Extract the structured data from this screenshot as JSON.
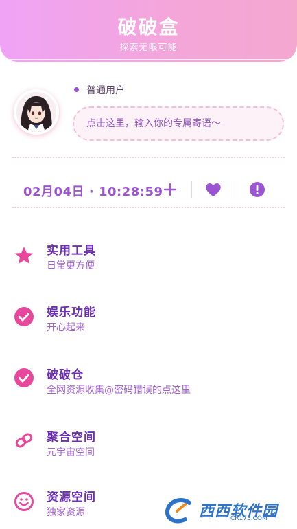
{
  "header": {
    "title": "破破盒",
    "subtitle": "探索无限可能"
  },
  "profile": {
    "user_type": "普通用户",
    "motto_placeholder": "点击这里，输入你的专属寄语～"
  },
  "datebar": {
    "datetime": "02月04日 · 10:28:59",
    "plus_icon": "plus-icon",
    "heart_icon": "heart-icon",
    "alert_icon": "alert-icon"
  },
  "menu": [
    {
      "title": "实用工具",
      "desc": "日常更方便",
      "icon": "star-icon"
    },
    {
      "title": "娱乐功能",
      "desc": "开心起来",
      "icon": "check-circle-icon"
    },
    {
      "title": "破破仓",
      "desc": "全网资源收集@密码错误的点这里",
      "icon": "check-circle-icon"
    },
    {
      "title": "聚合空间",
      "desc": "元宇宙空间",
      "icon": "link-icon"
    },
    {
      "title": "资源空间",
      "desc": "独家资源",
      "icon": "smile-icon"
    }
  ],
  "watermark": {
    "text": "西西软件园",
    "sub": "CR173.COM"
  },
  "colors": {
    "accent": "#9c55d2",
    "pink": "#e8489c",
    "header_start": "#f0a3f5",
    "header_end": "#f4a7cf"
  }
}
